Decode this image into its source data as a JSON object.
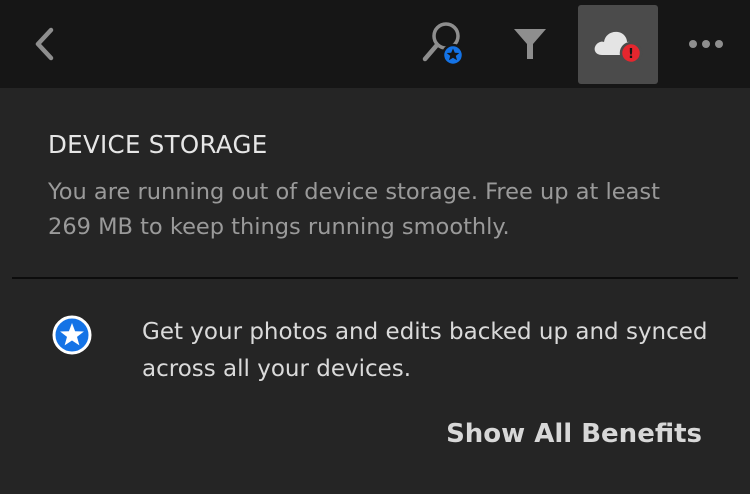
{
  "toolbar": {
    "icons": {
      "back": "chevron-left-icon",
      "search": "search-star-icon",
      "filter": "funnel-icon",
      "cloud": "cloud-alert-icon",
      "more": "more-dots-icon"
    },
    "cloud_active": true,
    "alert_glyph": "!"
  },
  "storage": {
    "title": "DEVICE STORAGE",
    "message": "You are running out of device storage. Free up at least 269 MB to keep things running smoothly."
  },
  "benefit": {
    "text": "Get your photos and edits backed up and synced across all your devices.",
    "link_label": "Show All Benefits"
  },
  "colors": {
    "toolbar_bg": "#161616",
    "panel_bg": "#252525",
    "active_button_bg": "#4b4b4b",
    "alert_red": "#e5262e",
    "star_blue": "#1473e6"
  }
}
